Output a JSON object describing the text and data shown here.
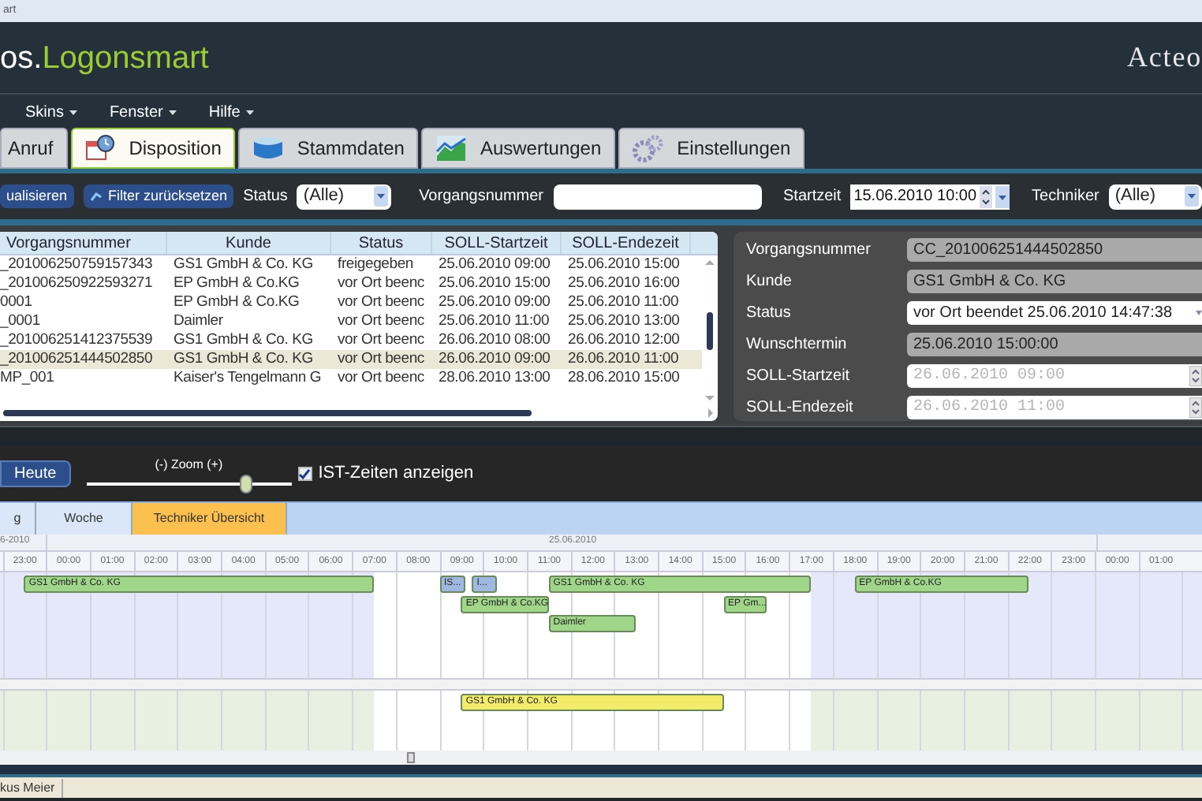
{
  "window": {
    "title": "art"
  },
  "header": {
    "logo_prefix": "os.",
    "logo_name": "Logonsmart",
    "brand": "Acteo"
  },
  "menu": [
    {
      "label": "Skins"
    },
    {
      "label": "Fenster"
    },
    {
      "label": "Hilfe"
    }
  ],
  "tabs": [
    {
      "label": "Anruf",
      "selected": false
    },
    {
      "label": "Disposition",
      "selected": true
    },
    {
      "label": "Stammdaten",
      "selected": false
    },
    {
      "label": "Auswertungen",
      "selected": false
    },
    {
      "label": "Einstellungen",
      "selected": false
    }
  ],
  "toolbar": {
    "refresh_button": "ualisieren",
    "reset_button": "Filter zurücksetzen",
    "status_label": "Status",
    "status_value": "(Alle)",
    "number_label": "Vorgangsnummer",
    "start_label": "Startzeit",
    "start_value": "15.06.2010 10:00",
    "tech_label": "Techniker",
    "tech_value": "(Alle)"
  },
  "table": {
    "columns": [
      "Vorgangsnummer",
      "Kunde",
      "Status",
      "SOLL-Startzeit",
      "SOLL-Endezeit"
    ],
    "rows": [
      {
        "selected": false,
        "cells": [
          "_201006250759157343",
          "GS1 GmbH & Co. KG",
          "freigegeben",
          "25.06.2010 09:00",
          "25.06.2010 15:00"
        ]
      },
      {
        "selected": false,
        "cells": [
          "_201006250922593271",
          "EP GmbH & Co.KG",
          "vor Ort beenc",
          "25.06.2010 15:00",
          "25.06.2010 16:00"
        ]
      },
      {
        "selected": false,
        "cells": [
          "0001",
          "EP GmbH & Co.KG",
          "vor Ort beenc",
          "25.06.2010 09:00",
          "25.06.2010 11:00"
        ]
      },
      {
        "selected": false,
        "cells": [
          "_0001",
          "Daimler",
          "vor Ort beenc",
          "25.06.2010 11:00",
          "25.06.2010 13:00"
        ]
      },
      {
        "selected": false,
        "cells": [
          "_201006251412375539",
          "GS1 GmbH & Co. KG",
          "vor Ort beenc",
          "26.06.2010 08:00",
          "26.06.2010 12:00"
        ]
      },
      {
        "selected": true,
        "cells": [
          "_201006251444502850",
          "GS1 GmbH & Co. KG",
          "vor Ort beenc",
          "26.06.2010 09:00",
          "26.06.2010 11:00"
        ]
      },
      {
        "selected": false,
        "cells": [
          "MP_001",
          "Kaiser's Tengelmann G",
          "vor Ort beenc",
          "28.06.2010 13:00",
          "28.06.2010 15:00"
        ]
      }
    ]
  },
  "details": [
    {
      "label": "Vorgangsnummer",
      "value": "CC_201006251444502850",
      "kind": "readonly"
    },
    {
      "label": "Kunde",
      "value": "GS1 GmbH & Co. KG",
      "kind": "readonly"
    },
    {
      "label": "Status",
      "value": "vor Ort beendet 25.06.2010 14:47:38",
      "kind": "dropdown"
    },
    {
      "label": "Wunschtermin",
      "value": "25.06.2010 15:00:00",
      "kind": "readonly"
    },
    {
      "label": "SOLL-Startzeit",
      "value": "26.06.2010 09:00",
      "kind": "spinner",
      "disabled": true
    },
    {
      "label": "SOLL-Endezeit",
      "value": "26.06.2010 11:00",
      "kind": "spinner",
      "disabled": true
    }
  ],
  "planner": {
    "today_button": "Heute",
    "zoom_label": "(-) Zoom (+)",
    "zoom": {
      "level": 0.8
    },
    "show_actual": {
      "label": "IST-Zeiten anzeigen",
      "checked": true
    },
    "views": [
      {
        "label": "g",
        "selected": false
      },
      {
        "label": "Woche",
        "selected": false
      },
      {
        "label": "Techniker Übersicht",
        "selected": true
      }
    ],
    "date_left": "6-2010",
    "date_center": "25.06.2010",
    "hours": [
      "23:00",
      "00:00",
      "01:00",
      "02:00",
      "03:00",
      "04:00",
      "05:00",
      "06:00",
      "07:00",
      "08:00",
      "09:00",
      "10:00",
      "11:00",
      "12:00",
      "13:00",
      "14:00",
      "15:00",
      "16:00",
      "17:00",
      "18:00",
      "19:00",
      "20:00",
      "21:00",
      "22:00",
      "23:00",
      "00:00",
      "01:00"
    ],
    "lanes": [
      {
        "bars": [
          {
            "label": "GS1 GmbH & Co. KG",
            "color": "#9fd68a"
          },
          {
            "label": "IS...",
            "color": "#9fb8e0"
          },
          {
            "label": "I...",
            "color": "#9fb8e0"
          },
          {
            "label": "GS1 GmbH & Co. KG",
            "color": "#9fd68a"
          },
          {
            "label": "EP GmbH & Co.KG",
            "color": "#9fd68a"
          },
          {
            "label": "EP GmbH & Co.KG",
            "color": "#9fd68a"
          },
          {
            "label": "EP Gm...",
            "color": "#9fd68a"
          },
          {
            "label": "Daimler",
            "color": "#9fd68a"
          }
        ]
      },
      {
        "bars": [
          {
            "label": "GS1 GmbH & Co. KG",
            "color": "#f3ec6a"
          }
        ]
      }
    ]
  },
  "status_bar": {
    "user": "kus Meier"
  }
}
